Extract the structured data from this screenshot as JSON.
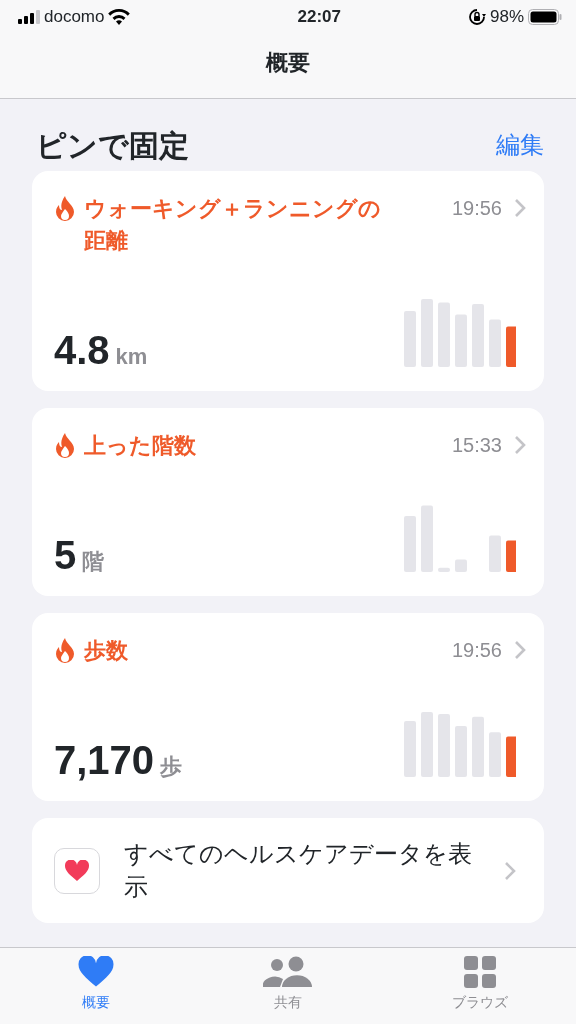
{
  "status_bar": {
    "carrier": "docomo",
    "time": "22:07",
    "battery": "98%"
  },
  "nav": {
    "title": "概要"
  },
  "section": {
    "title": "ピンで固定",
    "action": "編集"
  },
  "cards": [
    {
      "title": "ウォーキング＋ランニングの距離",
      "time": "19:56",
      "value": "4.8",
      "unit": "km"
    },
    {
      "title": "上った階数",
      "time": "15:33",
      "value": "5",
      "unit": "階"
    },
    {
      "title": "歩数",
      "time": "19:56",
      "value": "7,170",
      "unit": "歩"
    }
  ],
  "all_data": {
    "label": "すべてのヘルスケアデータを表示"
  },
  "tabs": [
    {
      "label": "概要",
      "selected": true,
      "kind": "heart"
    },
    {
      "label": "共有",
      "selected": false,
      "kind": "people"
    },
    {
      "label": "ブラウズ",
      "selected": false,
      "kind": "grid"
    }
  ]
}
